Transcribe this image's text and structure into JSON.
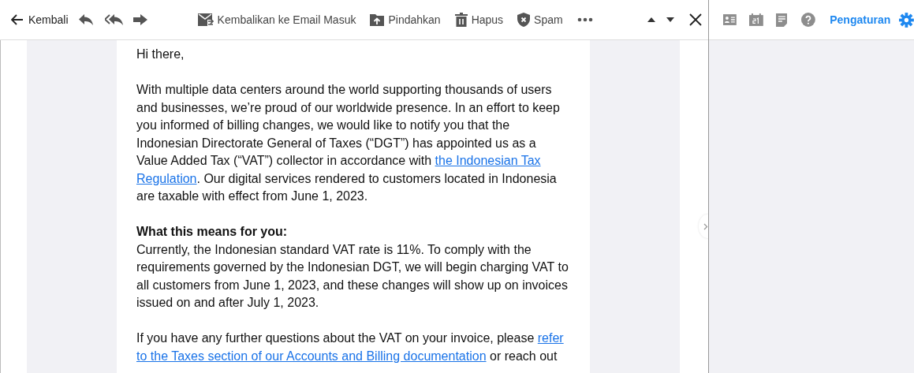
{
  "toolbar": {
    "back": {
      "label": "Kembali"
    },
    "actions": [
      {
        "label": "Kembalikan ke Email Masuk",
        "kind": "inbox"
      },
      {
        "label": "Pindahkan",
        "kind": "move"
      },
      {
        "label": "Hapus",
        "kind": "delete"
      },
      {
        "label": "Spam",
        "kind": "spam"
      }
    ]
  },
  "side_panel": {
    "settings_link": "Pengaturan"
  },
  "message": {
    "blocks": [
      {
        "kind": "text",
        "segments": [
          {
            "text": "Hi there,",
            "kind": "plain"
          }
        ]
      },
      {
        "kind": "text",
        "segments": [
          {
            "text": "With multiple data centers around the world supporting thousands of users and businesses, we’re proud of our worldwide presence. In an effort to keep you informed of billing changes, we would like to notify you that the Indonesian Directorate General of Taxes (“DGT”) has appointed us as a Value Added Tax (“VAT”) collector in accordance with",
            "kind": "plain"
          },
          {
            "text": "the Indonesian Tax",
            "kind": "link"
          },
          {
            "text": "Regulation",
            "kind": "link"
          },
          {
            "text": ". Our digital services rendered to customers located in Indonesia are taxable with effect from June 1, 2023.",
            "kind": "plain"
          }
        ]
      },
      {
        "kind": "heading",
        "segments": [
          {
            "text": "What this means for you:",
            "kind": "plain"
          }
        ]
      },
      {
        "kind": "text",
        "segments": [
          {
            "text": "Currently, the Indonesian standard VAT rate is 11%. To comply with the requirements governed by the Indonesian DGT, we will begin charging VAT to all customers from June 1, 2023, and these changes will show up on invoices issued on and after July 1, 2023.",
            "kind": "plain"
          }
        ]
      },
      {
        "kind": "text",
        "segments": [
          {
            "text": "If you have any further questions about the VAT on your invoice, please",
            "kind": "plain"
          },
          {
            "text": "refer",
            "kind": "link"
          },
          {
            "text": "to the Taxes section of our Accounts and Billing documentation",
            "kind": "link"
          },
          {
            "text": "or reach out",
            "kind": "plain"
          }
        ]
      }
    ]
  }
}
